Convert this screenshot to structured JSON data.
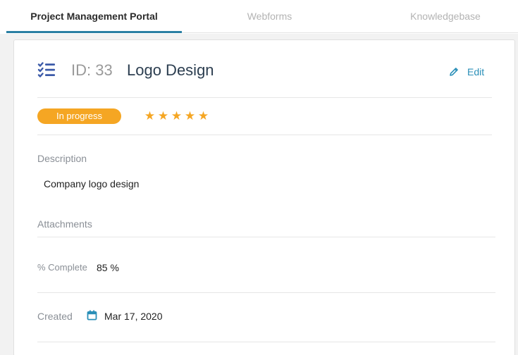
{
  "tabs": [
    {
      "label": "Project Management Portal",
      "active": true
    },
    {
      "label": "Webforms",
      "active": false
    },
    {
      "label": "Knowledgebase",
      "active": false
    }
  ],
  "task": {
    "id_label": "ID: 33",
    "title": "Logo Design",
    "edit_label": "Edit",
    "status": "In progress",
    "rating": 5,
    "rating_max": 5,
    "description_label": "Description",
    "description": "Company logo design",
    "attachments_label": "Attachments",
    "complete_label": "% Complete",
    "complete_value": "85 %",
    "created_label": "Created",
    "created_value": "Mar 17, 2020"
  },
  "icons": {
    "task": "checklist-icon",
    "edit": "pencil-icon",
    "created": "calendar-icon"
  },
  "colors": {
    "accent": "#2a8fb8",
    "tab_underline": "#2a7fa3",
    "status_badge": "#f5a623",
    "stars": "#f5a623",
    "task_icon": "#3b5aa8"
  }
}
